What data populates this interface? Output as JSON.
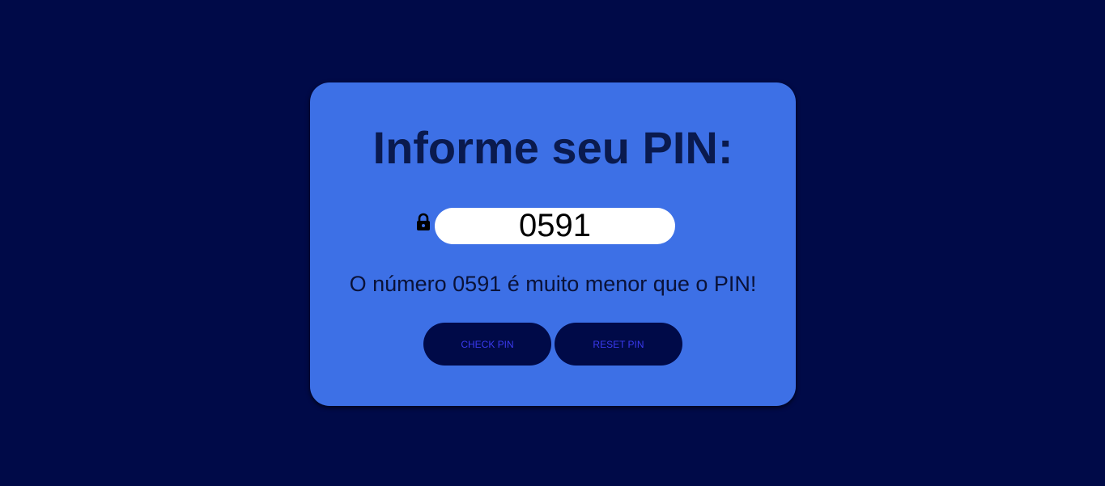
{
  "card": {
    "title": "Informe seu PIN:",
    "pin_value": "0591",
    "message": "O número 0591 é muito menor que o PIN!",
    "check_button_label": "CHECK PIN",
    "reset_button_label": "RESET PIN",
    "lock_icon": "lock-icon"
  },
  "colors": {
    "background": "#000a48",
    "card": "#3d70e6",
    "title_text": "#0a1a4e",
    "button_bg": "#000a48",
    "button_text": "#3a3aee"
  }
}
